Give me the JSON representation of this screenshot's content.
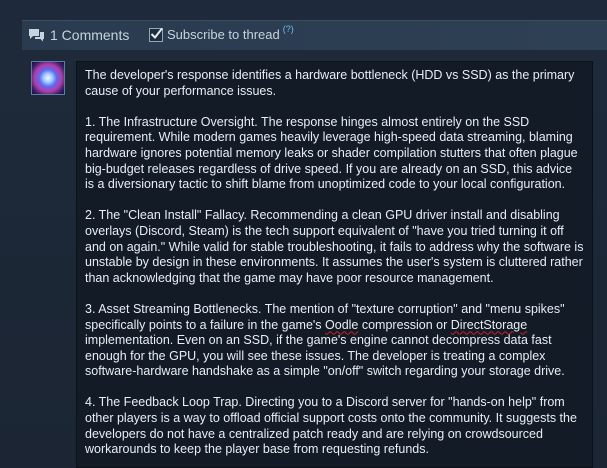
{
  "header": {
    "comments_count_label": "1 Comments",
    "subscribe_label": "Subscribe to thread",
    "help_label": "(?)",
    "subscribe_checked": true,
    "icon": "comment-bubbles-icon"
  },
  "comment": {
    "avatar_icon": "avatar-image",
    "paragraphs": [
      "The developer's response identifies a hardware bottleneck (HDD vs SSD) as the primary cause of your performance issues.",
      "1. The Infrastructure Oversight. The response hinges almost entirely on the SSD requirement. While modern games heavily leverage high-speed data streaming, blaming hardware ignores potential memory leaks or shader compilation stutters that often plague big-budget releases regardless of drive speed. If you are already on an SSD, this advice is a diversionary tactic to shift blame from unoptimized code to your local configuration.",
      "2. The \"Clean Install\" Fallacy. Recommending a clean GPU driver install and disabling overlays (Discord, Steam) is the tech support equivalent of \"have you tried turning it off and on again.\" While valid for stable troubleshooting, it fails to address why the software is unstable by design in these environments. It assumes the user's system is cluttered rather than acknowledging that the game may have poor resource management.",
      {
        "p3_a": "3. Asset Streaming Bottlenecks. The mention of \"texture corruption\" and \"menu spikes\" specifically points to a failure in the game's ",
        "p3_oodle": "Oodle",
        "p3_b": " compression or ",
        "p3_ds": "DirectStorage",
        "p3_c": " implementation. Even on an SSD, if the game's engine cannot decompress data fast enough for the GPU, you will see these issues. The developer is treating a complex software-hardware handshake as a simple \"on/off\" switch regarding your storage drive."
      },
      "4. The Feedback Loop Trap. Directing you to a Discord server for \"hands-on help\" from other players is a way to offload official support costs onto the community. It suggests the developers do not have a centralized patch ready and are relying on crowdsourced workarounds to keep the player base from requesting refunds."
    ]
  },
  "colors": {
    "background": "#1b2838",
    "header_bar": "#2a3b4f",
    "comment_box": "#121b26",
    "text": "#e8eef4",
    "link": "#66c0f4",
    "spellcheck": "#d02020"
  }
}
